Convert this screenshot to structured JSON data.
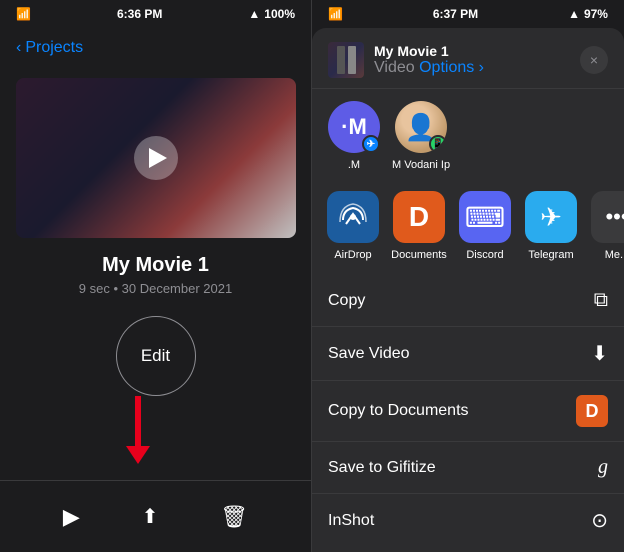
{
  "left": {
    "status": {
      "time": "6:36 PM",
      "battery": "100%"
    },
    "nav": {
      "back_label": "Projects"
    },
    "movie": {
      "title": "My Movie 1",
      "meta": "9 sec • 30 December 2021"
    },
    "edit_button": "Edit",
    "toolbar": {
      "play_icon": "▶",
      "share_icon": "⬆",
      "delete_icon": "🗑"
    }
  },
  "right": {
    "status": {
      "time": "6:37 PM",
      "battery": "97%"
    },
    "share_sheet": {
      "title": "My Movie 1",
      "type_label": "Video",
      "options_label": "Options ›",
      "close_label": "×"
    },
    "contacts": [
      {
        "name": ".M",
        "initials": "·M"
      },
      {
        "name": "M Vodani Ip",
        "initials": ""
      }
    ],
    "apps": [
      {
        "name": "AirDrop",
        "icon": "📡"
      },
      {
        "name": "Documents",
        "icon": "D"
      },
      {
        "name": "Discord",
        "icon": "💬"
      },
      {
        "name": "Telegram",
        "icon": "✈"
      },
      {
        "name": "Me...",
        "icon": "···"
      }
    ],
    "actions": [
      {
        "label": "Copy",
        "icon": "⎘"
      },
      {
        "label": "Save Video",
        "icon": "⬇"
      },
      {
        "label": "Copy to Documents",
        "icon": "D"
      },
      {
        "label": "Save to Gifitize",
        "icon": "g"
      },
      {
        "label": "InShot",
        "icon": "⊙"
      }
    ]
  }
}
